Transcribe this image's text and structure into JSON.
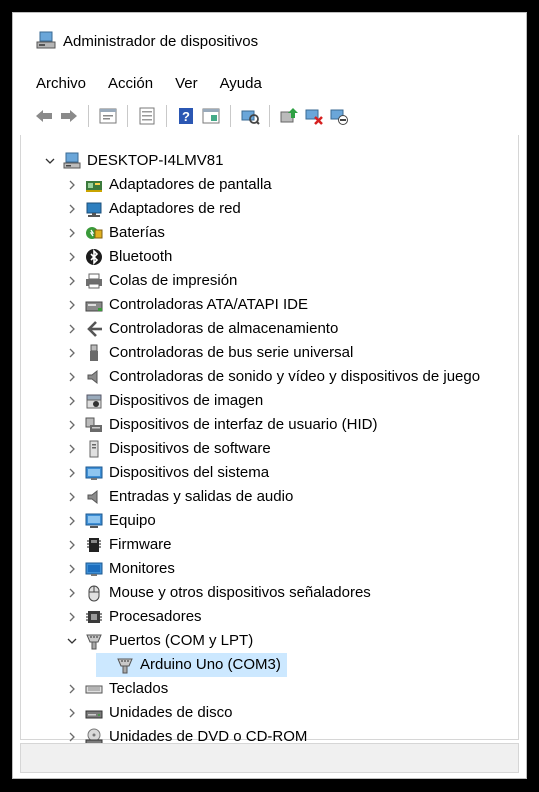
{
  "window": {
    "title": "Administrador de dispositivos"
  },
  "menu": [
    "Archivo",
    "Acción",
    "Ver",
    "Ayuda"
  ],
  "toolbar": [
    "back-icon",
    "forward-icon",
    "properties-icon",
    "view-icon",
    "help-icon",
    "show-hidden-icon",
    "scan-hardware-icon",
    "update-driver-icon",
    "uninstall-device-icon",
    "disable-device-icon"
  ],
  "tree": {
    "root": "DESKTOP-I4LMV81",
    "items": [
      {
        "label": "Adaptadores de pantalla",
        "icon": "display-adapter-icon"
      },
      {
        "label": "Adaptadores de red",
        "icon": "network-adapter-icon"
      },
      {
        "label": "Baterías",
        "icon": "battery-icon"
      },
      {
        "label": "Bluetooth",
        "icon": "bluetooth-icon"
      },
      {
        "label": "Colas de impresión",
        "icon": "printer-icon"
      },
      {
        "label": "Controladoras ATA/ATAPI IDE",
        "icon": "ide-controller-icon"
      },
      {
        "label": "Controladoras de almacenamiento",
        "icon": "storage-controller-icon"
      },
      {
        "label": "Controladoras de bus serie universal",
        "icon": "usb-icon"
      },
      {
        "label": "Controladoras de sonido y vídeo y dispositivos de juego",
        "icon": "speaker-icon"
      },
      {
        "label": "Dispositivos de imagen",
        "icon": "camera-icon"
      },
      {
        "label": "Dispositivos de interfaz de usuario (HID)",
        "icon": "hid-icon"
      },
      {
        "label": "Dispositivos de software",
        "icon": "software-device-icon"
      },
      {
        "label": "Dispositivos del sistema",
        "icon": "system-device-icon"
      },
      {
        "label": "Entradas y salidas de audio",
        "icon": "audio-io-icon"
      },
      {
        "label": "Equipo",
        "icon": "computer-icon"
      },
      {
        "label": "Firmware",
        "icon": "firmware-icon"
      },
      {
        "label": "Monitores",
        "icon": "monitor-icon"
      },
      {
        "label": "Mouse y otros dispositivos señaladores",
        "icon": "mouse-icon"
      },
      {
        "label": "Procesadores",
        "icon": "processor-icon"
      },
      {
        "label": "Puertos (COM y LPT)",
        "icon": "port-icon",
        "expanded": true,
        "children": [
          {
            "label": "Arduino Uno (COM3)",
            "icon": "port-icon",
            "selected": true
          }
        ]
      },
      {
        "label": "Teclados",
        "icon": "keyboard-icon"
      },
      {
        "label": "Unidades de disco",
        "icon": "disk-drive-icon"
      },
      {
        "label": "Unidades de DVD o CD-ROM",
        "icon": "dvd-drive-icon"
      }
    ]
  },
  "colors": {
    "selection": "#cce8ff",
    "accent": "#0078d7"
  }
}
